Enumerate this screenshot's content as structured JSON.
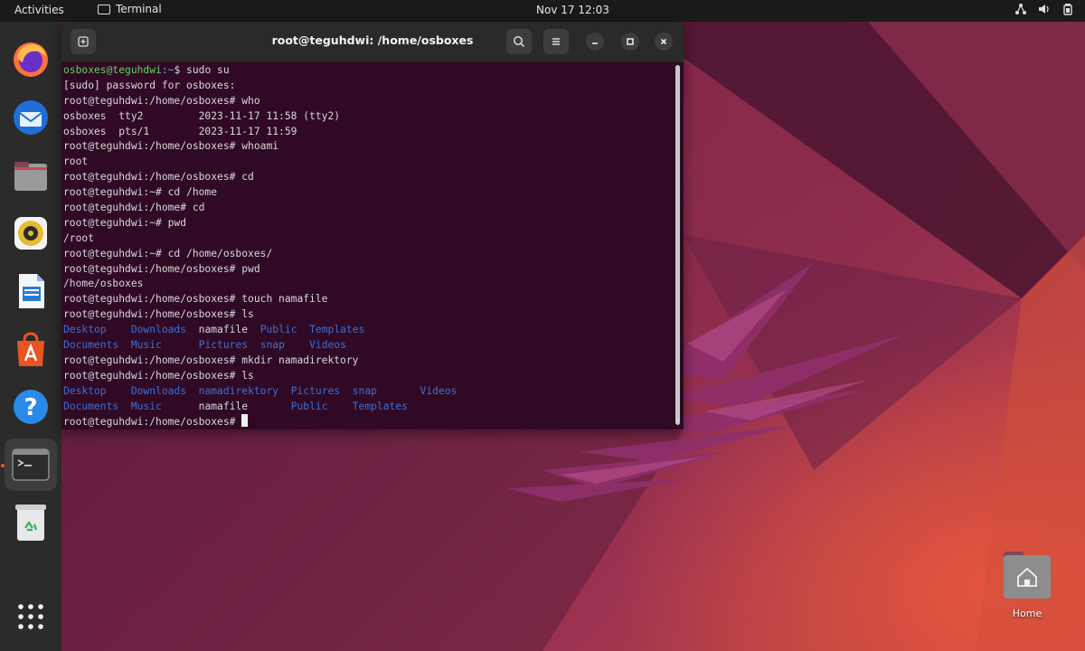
{
  "topbar": {
    "activities_label": "Activities",
    "app_name": "Terminal",
    "clock": "Nov 17  12:03"
  },
  "dock": {
    "items": [
      {
        "name": "firefox-icon"
      },
      {
        "name": "thunderbird-icon"
      },
      {
        "name": "files-icon"
      },
      {
        "name": "rhythmbox-icon"
      },
      {
        "name": "libreoffice-writer-icon"
      },
      {
        "name": "app-center-icon"
      },
      {
        "name": "help-icon"
      },
      {
        "name": "terminal-icon"
      },
      {
        "name": "trash-icon"
      },
      {
        "name": "show-apps-icon"
      }
    ],
    "accent_color": "#e95420"
  },
  "terminal": {
    "title": "root@teguhdwi: /home/osboxes",
    "background": "#300a24",
    "lines": [
      {
        "user": "osboxes@teguhdwi",
        "path": ":~",
        "text": "$ sudo su"
      },
      {
        "text": "[sudo] password for osboxes:"
      },
      {
        "text": "root@teguhdwi:/home/osboxes# who"
      },
      {
        "text": "osboxes  tty2         2023-11-17 11:58 (tty2)"
      },
      {
        "text": "osboxes  pts/1        2023-11-17 11:59"
      },
      {
        "text": "root@teguhdwi:/home/osboxes# whoami"
      },
      {
        "text": "root"
      },
      {
        "text": "root@teguhdwi:/home/osboxes# cd"
      },
      {
        "text": "root@teguhdwi:~# cd /home"
      },
      {
        "text": "root@teguhdwi:/home# cd"
      },
      {
        "text": "root@teguhdwi:~# pwd"
      },
      {
        "text": "/root"
      },
      {
        "text": "root@teguhdwi:~# cd /home/osboxes/"
      },
      {
        "text": "root@teguhdwi:/home/osboxes# pwd"
      },
      {
        "text": "/home/osboxes"
      },
      {
        "text": "root@teguhdwi:/home/osboxes# touch namafile"
      },
      {
        "text": "root@teguhdwi:/home/osboxes# ls"
      },
      {
        "ls": [
          [
            "Desktop",
            true
          ],
          [
            "    ",
            false
          ],
          [
            "Downloads",
            true
          ],
          [
            "  ",
            false
          ],
          [
            "namafile",
            false
          ],
          [
            "  ",
            false
          ],
          [
            "Public",
            true
          ],
          [
            "  ",
            false
          ],
          [
            "Templates",
            true
          ]
        ]
      },
      {
        "ls": [
          [
            "Documents",
            true
          ],
          [
            "  ",
            false
          ],
          [
            "Music",
            true
          ],
          [
            "      ",
            false
          ],
          [
            "Pictures",
            true
          ],
          [
            "  ",
            false
          ],
          [
            "snap",
            true
          ],
          [
            "    ",
            false
          ],
          [
            "Videos",
            true
          ]
        ]
      },
      {
        "text": "root@teguhdwi:/home/osboxes# mkdir namadirektory"
      },
      {
        "text": "root@teguhdwi:/home/osboxes# ls"
      },
      {
        "ls": [
          [
            "Desktop",
            true
          ],
          [
            "    ",
            false
          ],
          [
            "Downloads",
            true
          ],
          [
            "  ",
            false
          ],
          [
            "namadirektory",
            true
          ],
          [
            "  ",
            false
          ],
          [
            "Pictures",
            true
          ],
          [
            "  ",
            false
          ],
          [
            "snap",
            true
          ],
          [
            "       ",
            false
          ],
          [
            "Videos",
            true
          ]
        ]
      },
      {
        "ls": [
          [
            "Documents",
            true
          ],
          [
            "  ",
            false
          ],
          [
            "Music",
            true
          ],
          [
            "      ",
            false
          ],
          [
            "namafile",
            false
          ],
          [
            "       ",
            false
          ],
          [
            "Public",
            true
          ],
          [
            "    ",
            false
          ],
          [
            "Templates",
            true
          ]
        ]
      },
      {
        "text": "root@teguhdwi:/home/osboxes# ",
        "cursor": true
      }
    ]
  },
  "desktop": {
    "home_label": "Home"
  }
}
